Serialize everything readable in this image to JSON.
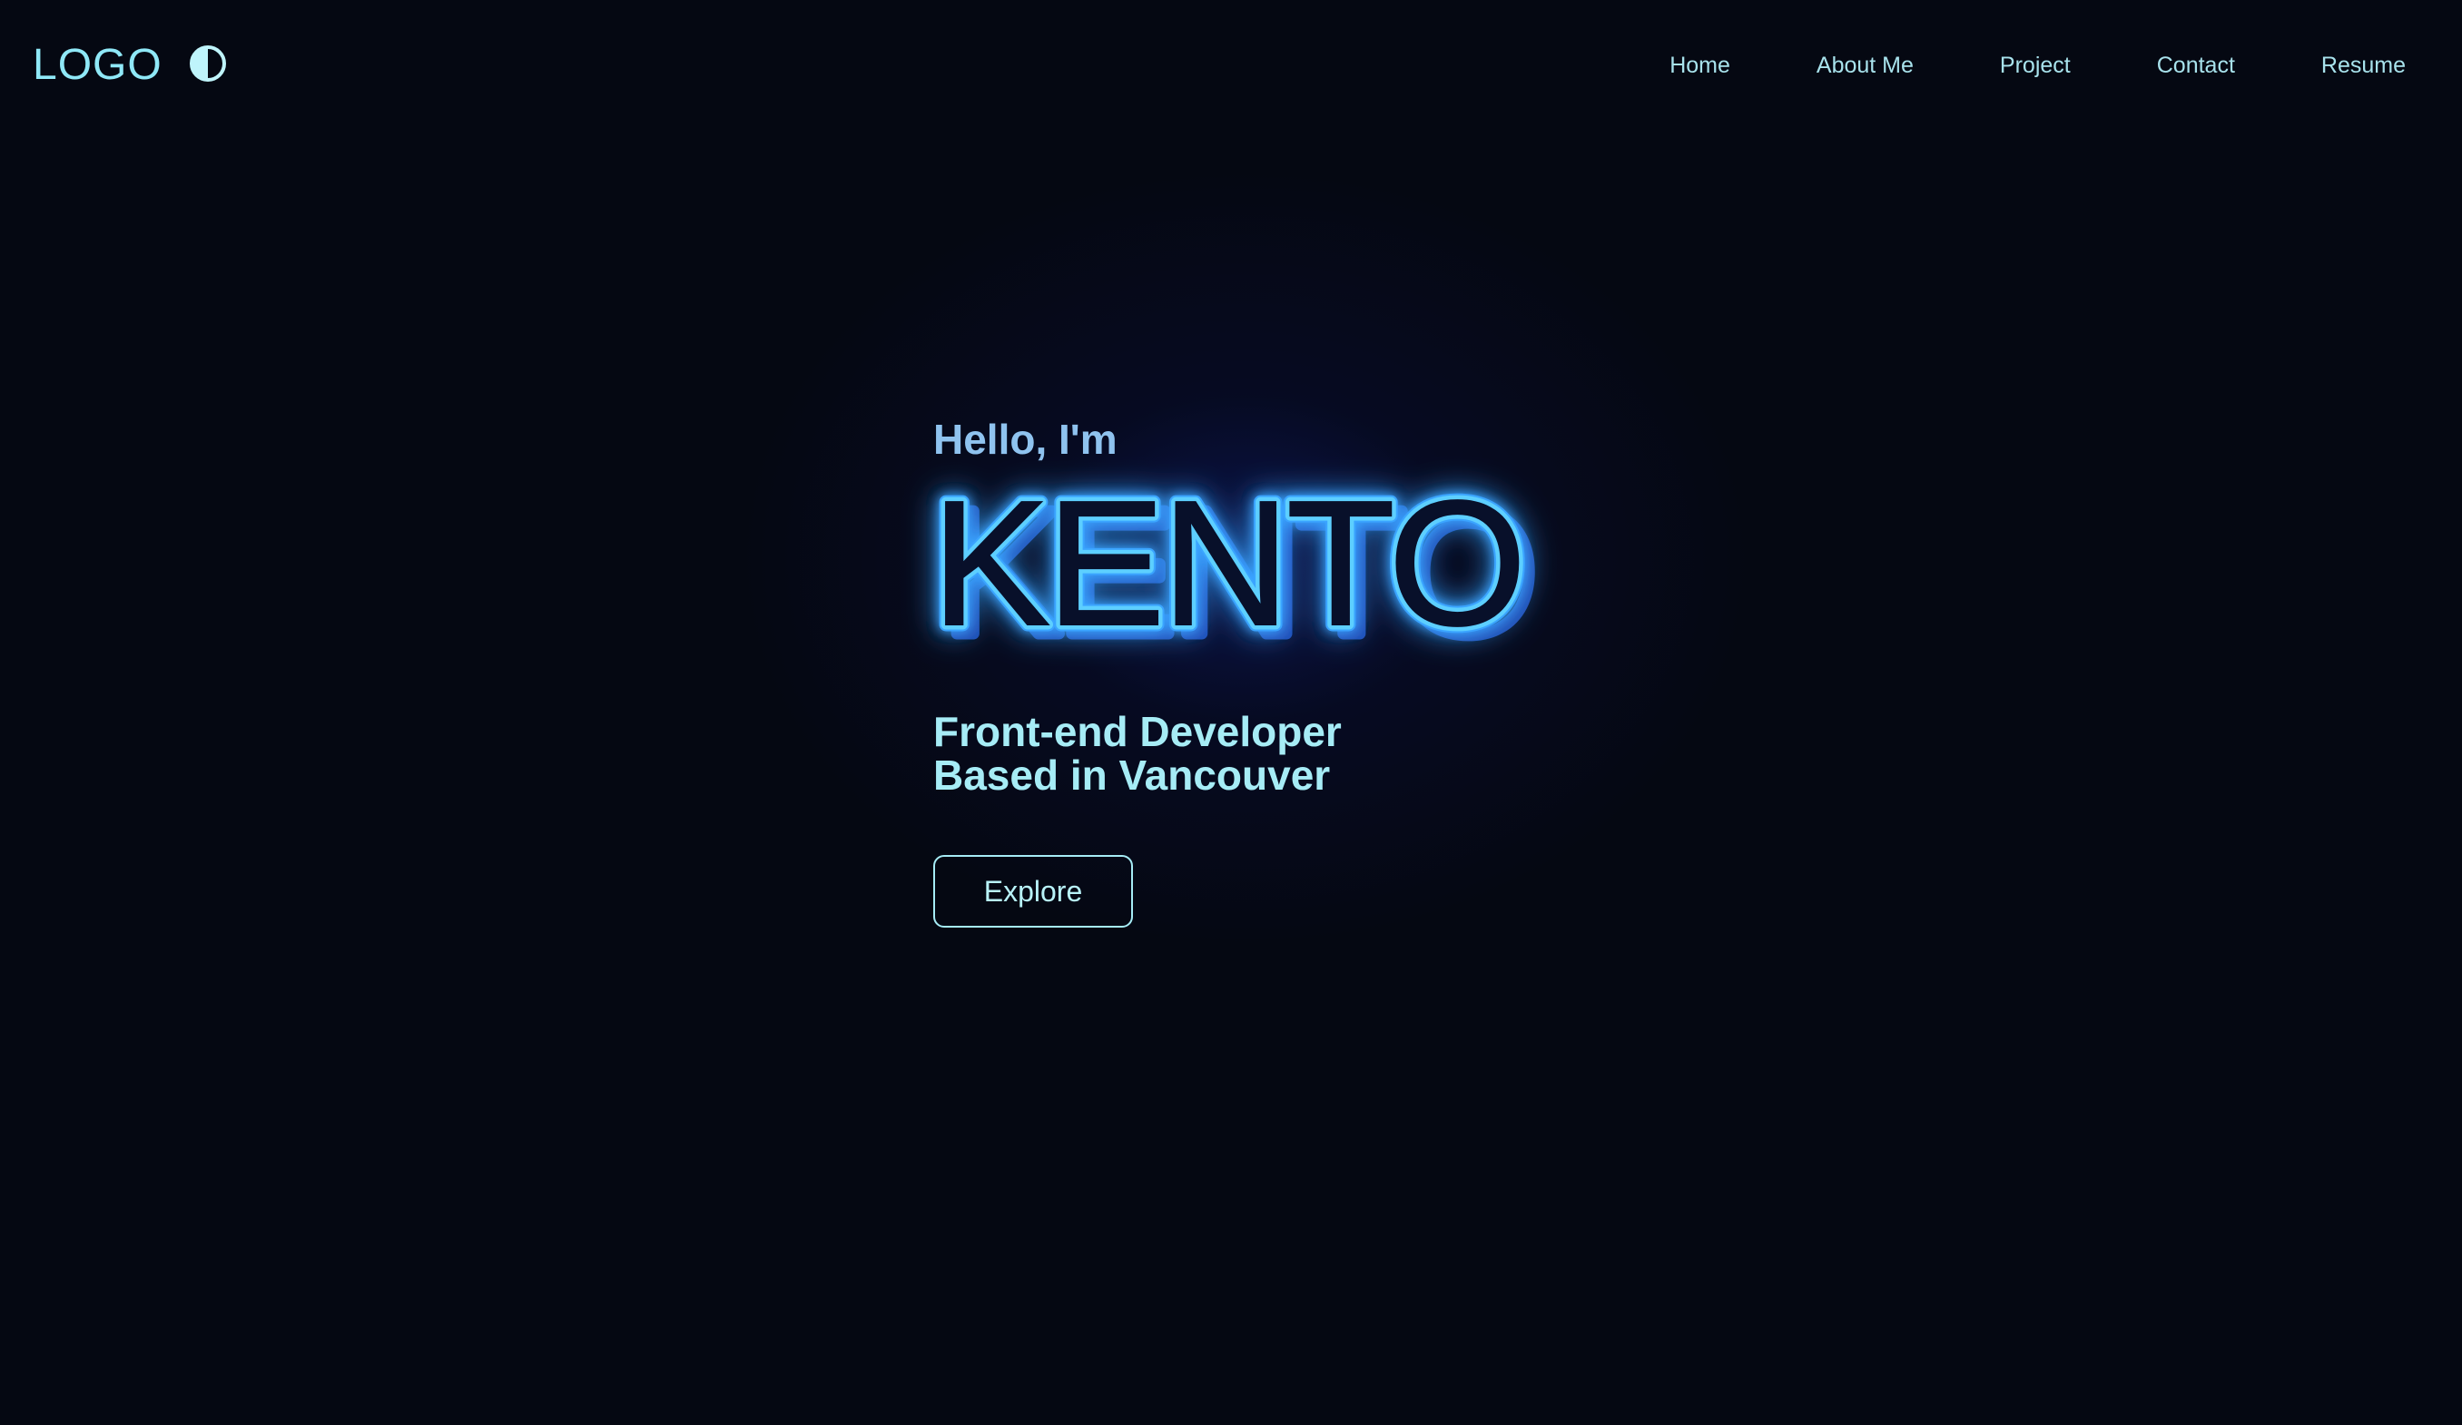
{
  "header": {
    "logo_text": "LOGO",
    "theme_toggle_icon": "contrast-half-circle-icon",
    "nav": [
      {
        "label": "Home"
      },
      {
        "label": "About Me"
      },
      {
        "label": "Project"
      },
      {
        "label": "Contact"
      },
      {
        "label": "Resume"
      }
    ]
  },
  "hero": {
    "greeting": "Hello, I'm",
    "name": "KENTO",
    "tagline_line1": "Front-end Developer",
    "tagline_line2": "Based in Vancouver",
    "cta_label": "Explore"
  },
  "colors": {
    "background": "#050812",
    "accent_cyan": "#a6ecf6",
    "neon_blue": "#57c8ff",
    "glow_blue": "#1e3fd1"
  }
}
